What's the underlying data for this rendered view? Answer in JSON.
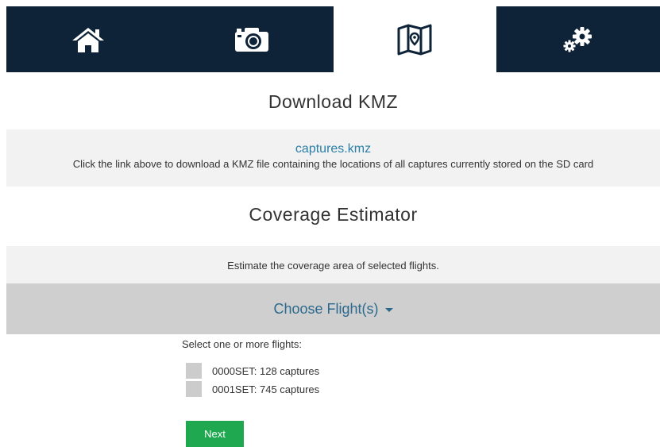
{
  "nav": {
    "tabs": [
      {
        "icon": "home-icon",
        "active": false
      },
      {
        "icon": "camera-icon",
        "active": false
      },
      {
        "icon": "map-icon",
        "active": true
      },
      {
        "icon": "gears-icon",
        "active": false
      }
    ]
  },
  "download": {
    "title": "Download KMZ",
    "link_text": "captures.kmz",
    "description": "Click the link above to download a KMZ file containing the locations of all captures currently stored on the SD card"
  },
  "coverage": {
    "title": "Coverage Estimator",
    "description": "Estimate the coverage area of selected flights.",
    "dropdown_label": "Choose Flight(s)",
    "select_label": "Select one or more flights:",
    "flights": [
      {
        "label": "0000SET: 128 captures",
        "checked": false
      },
      {
        "label": "0001SET: 745 captures",
        "checked": false
      }
    ],
    "next_label": "Next"
  },
  "colors": {
    "nav_bg": "#0e2338",
    "link": "#2a7fa6",
    "dropdown_text": "#2b6a8e",
    "next_button": "#1fa84f"
  }
}
